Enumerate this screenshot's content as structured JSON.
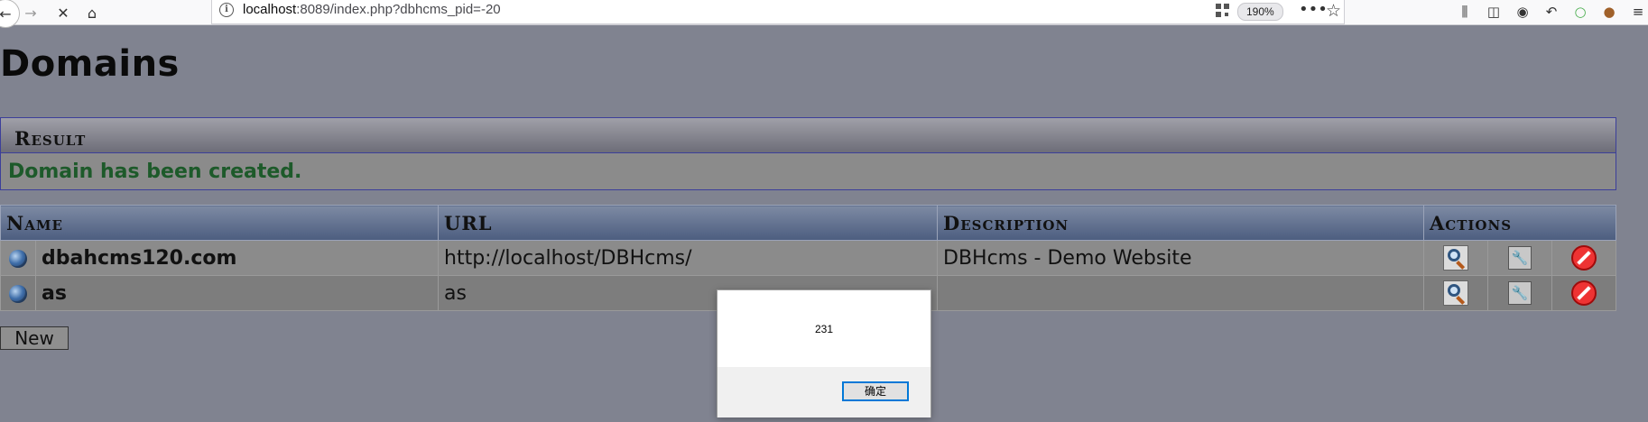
{
  "browser": {
    "url_host": "localhost",
    "url_rest": ":8089/index.php?dbhcms_pid=-20",
    "zoom": "190%",
    "nav_icons": [
      "back-arrow-icon",
      "forward-arrow-icon",
      "stop-icon",
      "home-icon"
    ],
    "toolbar_icons": [
      "library-icon",
      "sidebar-icon",
      "sync-icon",
      "undo-icon",
      "extension-icon",
      "cookie-icon"
    ]
  },
  "page": {
    "title": "Domains",
    "result": {
      "heading": "Result",
      "message": "Domain has been created."
    },
    "table": {
      "headers": [
        "Name",
        "URL",
        "Description",
        "Actions"
      ],
      "rows": [
        {
          "name": "dbahcms120.com",
          "url": "http://localhost/DBHcms/",
          "description": "DBHcms - Demo Website"
        },
        {
          "name": "as",
          "url": "as",
          "description": ""
        }
      ]
    },
    "new_button": "New"
  },
  "dialog": {
    "message": "231",
    "ok_button": "确定"
  },
  "colors": {
    "page_bg": "#808390",
    "result_text": "#1d5a2a",
    "dialog_focus": "#0078d7"
  }
}
